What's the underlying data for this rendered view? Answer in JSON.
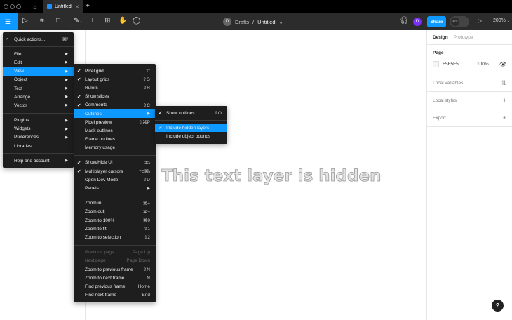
{
  "tabbar": {
    "tab_title": "Untitled",
    "plus": "+",
    "more": "···",
    "home_icon": "home-icon"
  },
  "toolbar": {
    "breadcrumb_avatar": "D",
    "breadcrumb_team": "Drafts",
    "breadcrumb_sep": "/",
    "file_name": "Untitled",
    "user_avatar": "D",
    "share": "Share",
    "zoom": "200%"
  },
  "canvas": {
    "hidden_text": "This text layer is hidden"
  },
  "right_panel": {
    "tabs": [
      "Design",
      "Prototype"
    ],
    "page_title": "Page",
    "page_color": "F5F5F5",
    "page_opacity": "100%",
    "sections": [
      "Local variables",
      "Local styles",
      "Export"
    ]
  },
  "help": "?",
  "colors": {
    "accent": "#0d99ff",
    "menu_bg": "#1e1e1e",
    "toolbar_bg": "#2c2c2c",
    "page": "#F5F5F5"
  },
  "main_menu": [
    {
      "label": "Quick actions...",
      "shortcut": "⌘/",
      "icon": "search"
    },
    {
      "sep": true
    },
    {
      "label": "File",
      "sub": true
    },
    {
      "label": "Edit",
      "sub": true
    },
    {
      "label": "View",
      "sub": true,
      "hl": true
    },
    {
      "label": "Object",
      "sub": true
    },
    {
      "label": "Text",
      "sub": true
    },
    {
      "label": "Arrange",
      "sub": true
    },
    {
      "label": "Vector",
      "sub": true
    },
    {
      "sep": true
    },
    {
      "label": "Plugins",
      "sub": true
    },
    {
      "label": "Widgets",
      "sub": true
    },
    {
      "label": "Preferences",
      "sub": true
    },
    {
      "label": "Libraries"
    },
    {
      "sep": true
    },
    {
      "label": "Help and account",
      "sub": true
    }
  ],
  "view_menu": [
    {
      "label": "Pixel grid",
      "shortcut": "⇧'",
      "checked": true
    },
    {
      "label": "Layout grids",
      "shortcut": "⇧G",
      "checked": true
    },
    {
      "label": "Rulers",
      "shortcut": "⇧R"
    },
    {
      "label": "Show slices",
      "checked": true
    },
    {
      "label": "Comments",
      "shortcut": "⇧C",
      "checked": true
    },
    {
      "label": "Outlines",
      "sub": true,
      "hl": true
    },
    {
      "label": "Pixel preview",
      "shortcut": "⇧⌘P"
    },
    {
      "label": "Mask outlines"
    },
    {
      "label": "Frame outlines"
    },
    {
      "label": "Memory usage"
    },
    {
      "sep": true
    },
    {
      "label": "Show/Hide UI",
      "shortcut": "⌘\\",
      "checked": true
    },
    {
      "label": "Multiplayer cursors",
      "shortcut": "⌥⌘\\",
      "checked": true
    },
    {
      "label": "Open Dev Mode",
      "shortcut": "⇧D"
    },
    {
      "label": "Panels",
      "sub": true
    },
    {
      "sep": true
    },
    {
      "label": "Zoom in",
      "shortcut": "⌘+"
    },
    {
      "label": "Zoom out",
      "shortcut": "⌘−"
    },
    {
      "label": "Zoom to 100%",
      "shortcut": "⌘0"
    },
    {
      "label": "Zoom to fit",
      "shortcut": "⇧1"
    },
    {
      "label": "Zoom to selection",
      "shortcut": "⇧2"
    },
    {
      "sep": true
    },
    {
      "label": "Previous page",
      "shortcut": "Page Up",
      "disabled": true
    },
    {
      "label": "Next page",
      "shortcut": "Page Down",
      "disabled": true
    },
    {
      "label": "Zoom to previous frame",
      "shortcut": "⇧N"
    },
    {
      "label": "Zoom to next frame",
      "shortcut": "N"
    },
    {
      "label": "Find previous frame",
      "shortcut": "Home"
    },
    {
      "label": "Find next frame",
      "shortcut": "End"
    }
  ],
  "outlines_menu": [
    {
      "label": "Show outlines",
      "shortcut": "⇧O",
      "checked": true
    },
    {
      "sep": true
    },
    {
      "label": "Include hidden layers",
      "checked": true,
      "hl": true
    },
    {
      "label": "Include object bounds"
    }
  ]
}
